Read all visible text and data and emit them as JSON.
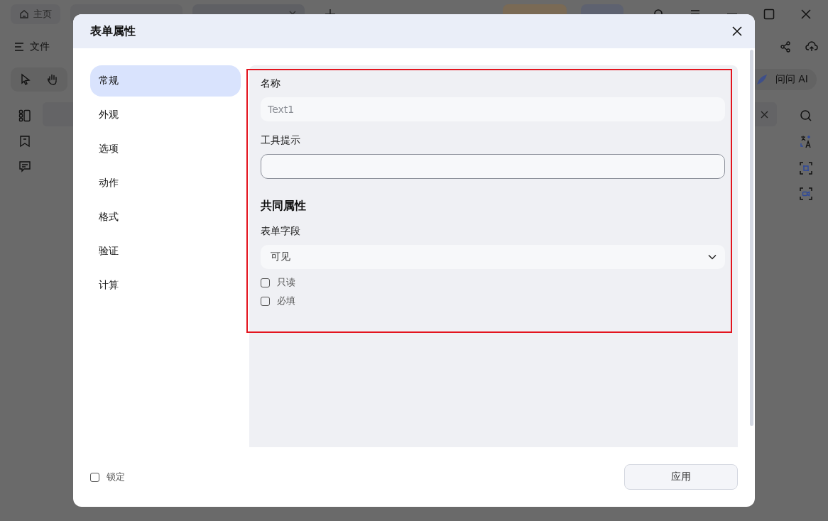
{
  "app": {
    "tabs": [
      {
        "label": "主页",
        "kind": "home",
        "selected": false
      },
      {
        "kind": "doc",
        "selected": false
      },
      {
        "kind": "doc",
        "selected": true
      }
    ],
    "menu": "文件",
    "ai_button": "问问 AI"
  },
  "dialog": {
    "title": "表单属性",
    "nav": [
      {
        "label": "常规",
        "selected": true
      },
      {
        "label": "外观",
        "selected": false
      },
      {
        "label": "选项",
        "selected": false
      },
      {
        "label": "动作",
        "selected": false
      },
      {
        "label": "格式",
        "selected": false
      },
      {
        "label": "验证",
        "selected": false
      },
      {
        "label": "计算",
        "selected": false
      }
    ],
    "fields": [
      {
        "label": "名称",
        "value": "Text1",
        "disabled": true
      },
      {
        "label": "工具提示",
        "disabled": false
      }
    ],
    "section_title": "共同属性",
    "form_field": {
      "label": "表单字段",
      "value": "可见"
    },
    "checkboxes": [
      {
        "label": "只读",
        "checked": false
      },
      {
        "label": "必填",
        "checked": false
      }
    ],
    "lock": {
      "label": "锁定",
      "checked": false
    },
    "apply_button": "应用"
  }
}
